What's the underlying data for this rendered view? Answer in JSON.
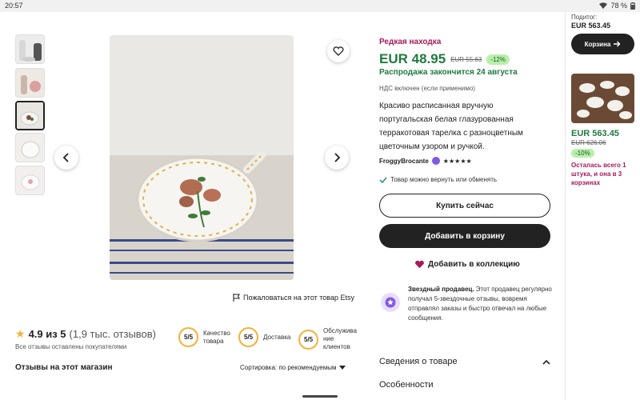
{
  "status": {
    "time": "20:57",
    "battery": "78 %"
  },
  "listing": {
    "report_link": "Пожаловаться на этот товар Etsy"
  },
  "product": {
    "rare_label": "Редкая находка",
    "price": "EUR 48.95",
    "old_price": "EUR 55.63",
    "discount": "-12%",
    "sale_end": "Распродажа закончится 24 августа",
    "vat": "НДС включен (если применимо)",
    "description": "Красиво расписанная вручную португальская белая глазурованная терракотовая тарелка с разноцветным цветочным узором и ручкой.",
    "seller_name": "FroggyBrocante",
    "seller_stars": "★★★★★",
    "returns": "Товар можно вернуть или обменять",
    "buy_now": "Купить сейчас",
    "add_to_cart": "Добавить в корзину",
    "add_to_collection": "Добавить в коллекцию",
    "star_seller_title": "Звездный продавец.",
    "star_seller_text": " Этот продавец регулярно получал 5-звездочные отзывы, вовремя отправлял заказы и быстро отвечал на любые сообщения.",
    "details_label": "Сведения о товаре",
    "features_label": "Особенности"
  },
  "reviews": {
    "score": "4.9 из 5",
    "count": "(1,9 тыс. отзывов)",
    "note": "Все отзывы оставлены покупателями",
    "metrics": [
      {
        "value": "5/5",
        "label": "Качество товара"
      },
      {
        "value": "5/5",
        "label": "Доставка"
      },
      {
        "value": "5/5",
        "label": "Обслужива ние клиентов"
      }
    ],
    "shop_reviews_title": "Отзывы на этот магазин",
    "sort_label": "Сортировка: по рекомендуемым"
  },
  "cart_panel": {
    "subtotal_label": "Подитог:",
    "subtotal_value": "EUR 563.45",
    "cart_button": "Корзина",
    "item_price": "EUR 563.45",
    "item_old_price": "EUR 626.06",
    "item_discount": "-10%",
    "item_stock": "Осталась всего 1 штука, и она в 3 корзинах"
  },
  "colors": {
    "price_green": "#1f7a3f",
    "accent_magenta": "#a6195b",
    "rating_gold": "#f1b33a",
    "discount_bg": "#b8f0a9"
  }
}
